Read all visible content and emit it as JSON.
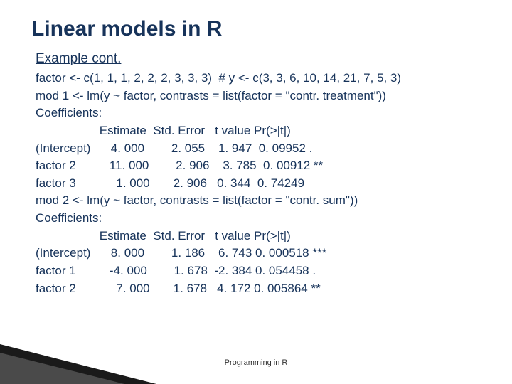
{
  "title": "Linear models in R",
  "subhead": "Example cont.",
  "lines": [
    "factor <- c(1, 1, 1, 2, 2, 2, 3, 3, 3)  # y <- c(3, 3, 6, 10, 14, 21, 7, 5, 3)",
    "mod 1 <- lm(y ~ factor, contrasts = list(factor = \"contr. treatment\"))",
    "Coefficients:",
    "                   Estimate  Std. Error   t value Pr(>|t|)",
    "(Intercept)      4. 000        2. 055    1. 947  0. 09952 .",
    "factor 2          11. 000        2. 906    3. 785  0. 00912 **",
    "factor 3            1. 000       2. 906   0. 344  0. 74249",
    "mod 2 <- lm(y ~ factor, contrasts = list(factor = \"contr. sum\"))",
    "Coefficients:",
    "                   Estimate  Std. Error   t value Pr(>|t|)",
    "(Intercept)      8. 000        1. 186    6. 743 0. 000518 ***",
    "factor 1          -4. 000        1. 678  -2. 384 0. 054458 .",
    "factor 2            7. 000       1. 678   4. 172 0. 005864 **"
  ],
  "footer": "Programming in R"
}
